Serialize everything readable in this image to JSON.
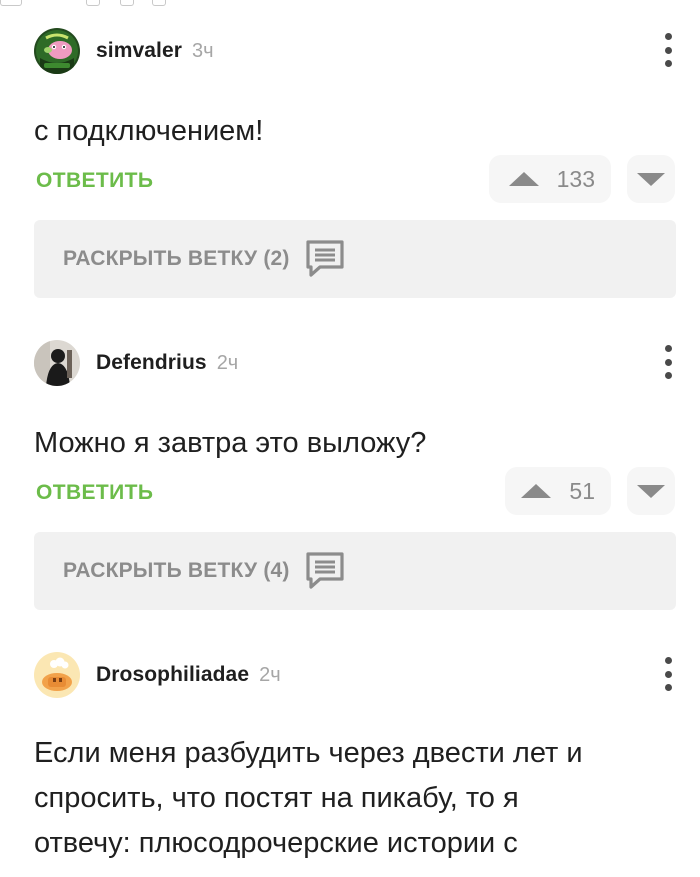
{
  "comments": [
    {
      "author": "simvaler",
      "time": "3ч",
      "text": "с подключением!",
      "reply_label": "ОТВЕТИТЬ",
      "rating": "133",
      "branch_label": "РАСКРЫТЬ ВЕТКУ (2)"
    },
    {
      "author": "Defendrius",
      "time": "2ч",
      "text": "Можно я завтра это выложу?",
      "reply_label": "ОТВЕТИТЬ",
      "rating": "51",
      "branch_label": "РАСКРЫТЬ ВЕТКУ (4)"
    },
    {
      "author": "Drosophiliadae",
      "time": "2ч",
      "text": "Если меня разбудить через двести лет и спросить, что постят на пикабу, то я отвечу: плюсодрочерские истории с"
    }
  ],
  "colors": {
    "accent_green": "#6cbc4a",
    "muted_text": "#8a8a8a",
    "branch_bg": "#f1f1f1"
  },
  "icons": {
    "more": "vertical-dots-icon",
    "upvote": "triangle-up-icon",
    "downvote": "triangle-down-icon",
    "branch": "comment-lines-icon"
  }
}
